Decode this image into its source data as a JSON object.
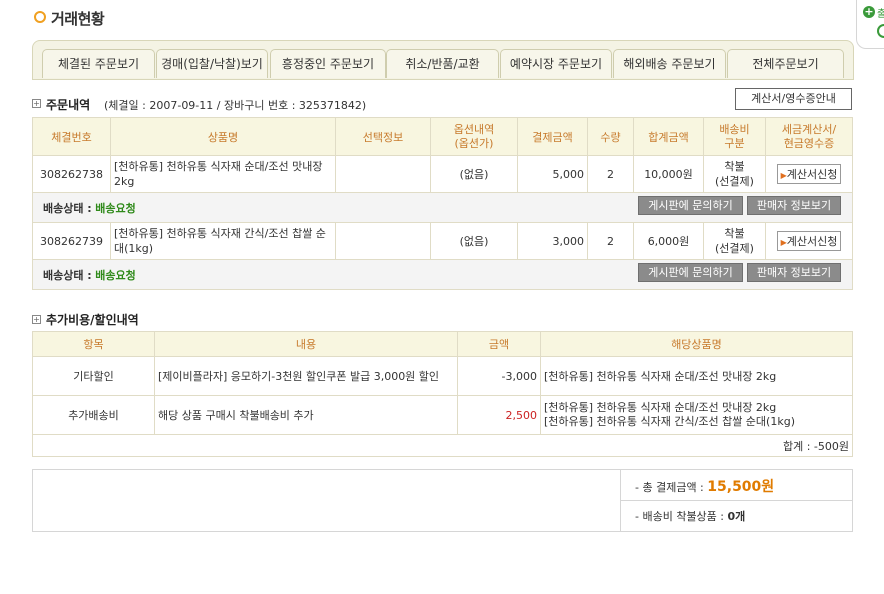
{
  "page": {
    "title": "거래현황"
  },
  "side_widget": {
    "label": "출"
  },
  "tabs": [
    {
      "label": "체결된 주문보기"
    },
    {
      "label": "경매(입찰/낙찰)보기"
    },
    {
      "label": "흥정중인 주문보기"
    },
    {
      "label": "취소/반품/교환"
    },
    {
      "label": "예약시장 주문보기"
    },
    {
      "label": "해외배송 주문보기"
    },
    {
      "label": "전체주문보기"
    }
  ],
  "order_section": {
    "title": "주문내역",
    "subtitle": "(체결일 : 2007-09-11 / 장바구니 번호 : 325371842)",
    "receipt_guide_button": "계산서/영수증안내",
    "headers": [
      "체결번호",
      "상품명",
      "선택정보",
      "옵션내역\n(옵션가)",
      "결제금액",
      "수량",
      "합계금액",
      "배송비\n구분",
      "세금계산서/\n현금영수증"
    ],
    "rows": [
      {
        "order_no": "308262738",
        "product": "[천하유통] 천하유통 식자재 순대/조선 맛내장 2kg",
        "select_info": "",
        "options": "(없음)",
        "price": "5,000",
        "qty": "2",
        "total": "10,000원",
        "shipping_type": "착불\n(선결제)",
        "receipt_button": "계산서신청",
        "ship_status_label": "배송상태 :",
        "ship_status": "배송요청",
        "inquiry_button": "게시판에 문의하기",
        "seller_button": "판매자 정보보기"
      },
      {
        "order_no": "308262739",
        "product": "[천하유통] 천하유통 식자재 간식/조선 찹쌀 순대(1kg)",
        "select_info": "",
        "options": "(없음)",
        "price": "3,000",
        "qty": "2",
        "total": "6,000원",
        "shipping_type": "착불\n(선결제)",
        "receipt_button": "계산서신청",
        "ship_status_label": "배송상태 :",
        "ship_status": "배송요청",
        "inquiry_button": "게시판에 문의하기",
        "seller_button": "판매자 정보보기"
      }
    ]
  },
  "extra_section": {
    "title": "추가비용/할인내역",
    "headers": [
      "항목",
      "내용",
      "금액",
      "해당상품명"
    ],
    "rows": [
      {
        "item": "기타할인",
        "content": "[제이비플라자] 응모하기-3천원 할인쿠폰 발급 3,000원 할인",
        "amount": "-3,000",
        "products": [
          "[천하유통] 천하유통 식자재 순대/조선 맛내장 2kg"
        ]
      },
      {
        "item": "추가배송비",
        "content": "해당 상품 구매시 착불배송비 추가",
        "amount": "2,500",
        "products": [
          "[천하유통] 천하유통 식자재 순대/조선 맛내장 2kg",
          "[천하유통] 천하유통 식자재 간식/조선 찹쌀 순대(1kg)"
        ]
      }
    ],
    "sum_label": "합계 : -500원"
  },
  "summary": {
    "total_label": "- 총 결제금액 :",
    "total_value": "15,500원",
    "shipping_label": "- 배송비 착불상품 :",
    "shipping_value": "0개"
  }
}
